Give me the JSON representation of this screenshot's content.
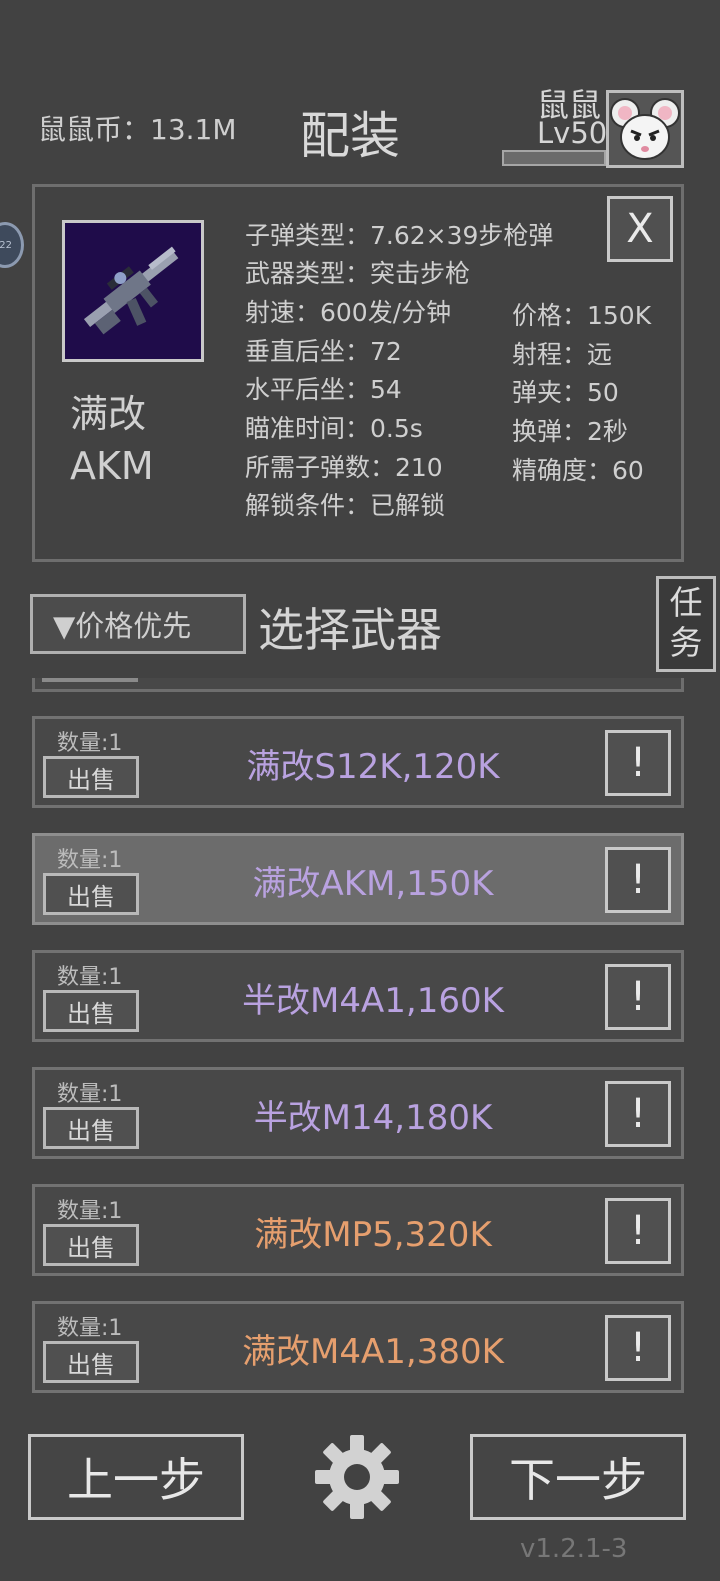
{
  "header": {
    "coins": "鼠鼠币：13.1M",
    "title": "配装",
    "player_name": "鼠鼠",
    "player_level": "Lv50",
    "side_badge": "22"
  },
  "detail": {
    "name": "满改AKM",
    "close_label": "X",
    "stats_left": [
      "子弹类型：7.62×39步枪弹",
      "武器类型：突击步枪",
      "射速：600发/分钟",
      "垂直后坐：72",
      "水平后坐：54",
      "瞄准时间：0.5s",
      "所需子弹数：210",
      "解锁条件：已解锁"
    ],
    "stats_right": [
      "价格：150K",
      "射程：远",
      "弹夹：50",
      "换弹：2秒",
      "精确度：60"
    ]
  },
  "list": {
    "sort_label": "▼价格优先",
    "heading": "选择武器",
    "task_label": "任务",
    "sell_label": "出售",
    "info_label": "!",
    "items": [
      {
        "qty": "数量:1",
        "label": "满改S12K,120K",
        "tier": "purple"
      },
      {
        "qty": "数量:1",
        "label": "满改AKM,150K",
        "tier": "purple"
      },
      {
        "qty": "数量:1",
        "label": "半改M4A1,160K",
        "tier": "purple"
      },
      {
        "qty": "数量:1",
        "label": "半改M14,180K",
        "tier": "purple"
      },
      {
        "qty": "数量:1",
        "label": "满改MP5,320K",
        "tier": "orange"
      },
      {
        "qty": "数量:1",
        "label": "满改M4A1,380K",
        "tier": "orange"
      }
    ],
    "selected_index": 1
  },
  "footer": {
    "prev_label": "上一步",
    "next_label": "下一步",
    "version": "v1.2.1-3"
  },
  "colors": {
    "background": "#424242",
    "purple_tier": "#b9a2e0",
    "orange_tier": "#e69f6e",
    "weapon_bg": "#1f0c4a"
  }
}
